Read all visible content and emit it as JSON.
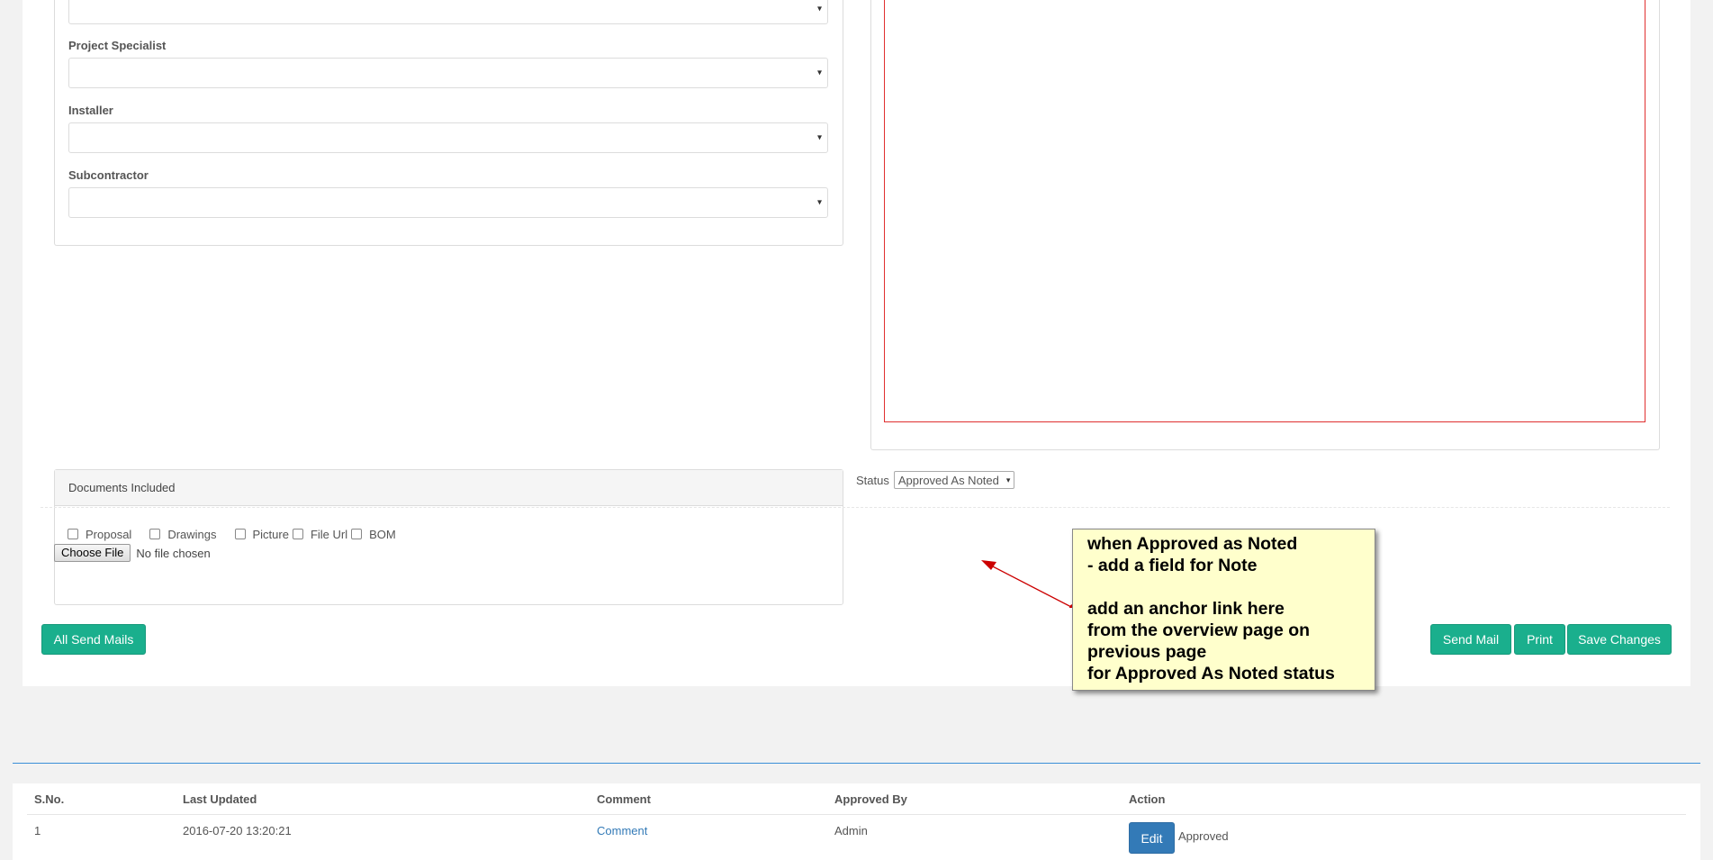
{
  "form": {
    "project_specialist_label": "Project Specialist",
    "installer_label": "Installer",
    "subcontractor_label": "Subcontractor",
    "select_caret": "▾"
  },
  "documents": {
    "header": "Documents Included",
    "checkboxes": [
      "Proposal",
      "Drawings",
      "Picture",
      "File Url",
      "BOM"
    ],
    "file_button": "Choose File",
    "file_status": "No file chosen"
  },
  "status": {
    "label": "Status",
    "value": "Approved As Noted",
    "caret": "▾"
  },
  "actions": {
    "all_send_mails": "All Send Mails",
    "send_mail": "Send Mail",
    "print": "Print",
    "save_changes": "Save Changes"
  },
  "annotation": {
    "lines": [
      "when Approved as Noted",
      "- add a field for Note",
      "",
      "add an anchor link here",
      "from the overview page on",
      "previous page",
      "for Approved As Noted status"
    ],
    "arrow_color": "#cc0000",
    "background_color": "#ffffcc"
  },
  "history_table": {
    "columns": [
      "S.No.",
      "Last Updated",
      "Comment",
      "Approved By",
      "Action"
    ],
    "rows": [
      {
        "sno": "1",
        "last_updated": "2016-07-20 13:20:21",
        "comment": "Comment",
        "approved_by": "Admin",
        "edit_label": "Edit",
        "status": "Approved"
      }
    ]
  },
  "colors": {
    "primary_green": "#1aaf8d",
    "primary_blue": "#337ab7",
    "red_border": "#e03030"
  }
}
